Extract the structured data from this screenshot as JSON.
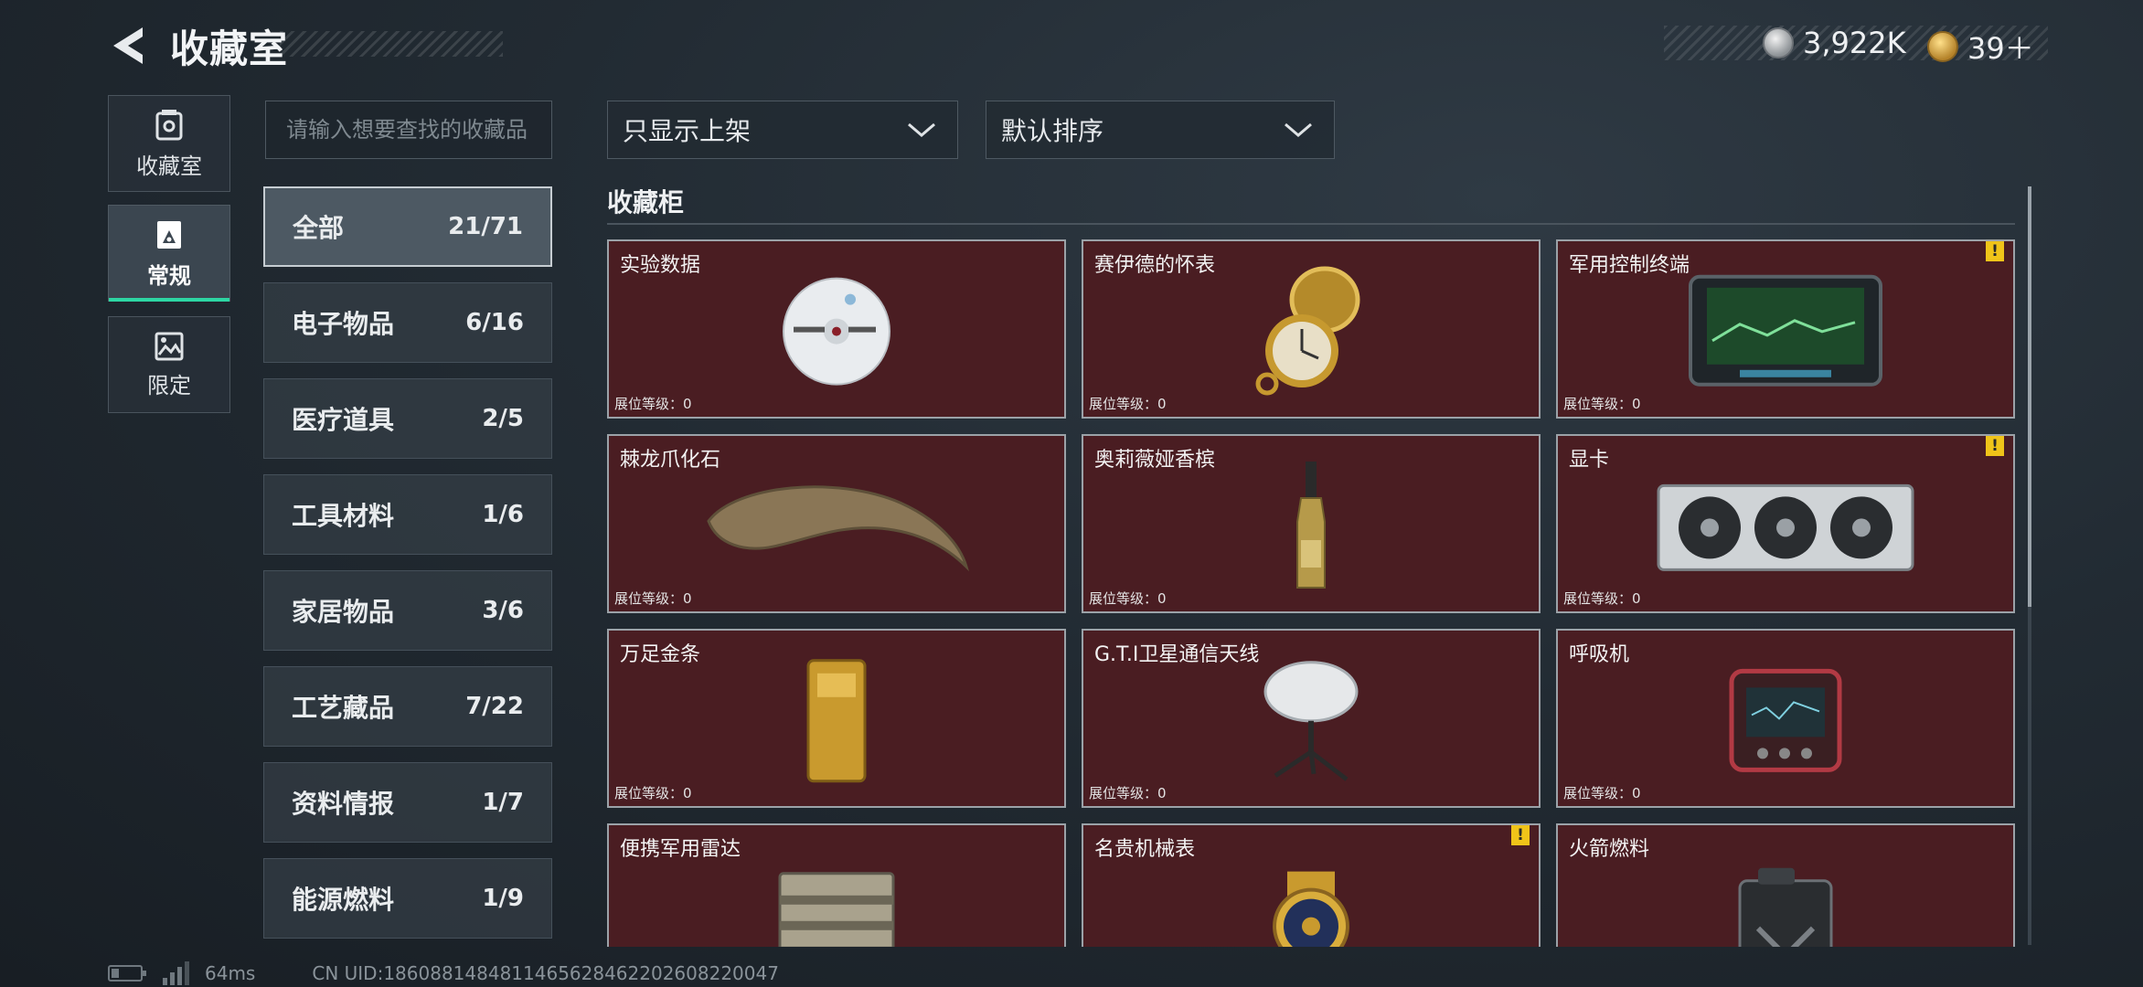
{
  "header": {
    "back_icon": "back-chevron-icon",
    "title": "收藏室",
    "currency": [
      {
        "icon": "silver-coin-icon",
        "value": "3,922K",
        "color": "#c9ccce"
      },
      {
        "icon": "gold-coin-icon",
        "value": "39＋",
        "color": "#d4a73d"
      }
    ]
  },
  "nav_tabs": [
    {
      "label": "收藏室",
      "icon": "vault-icon",
      "active": false
    },
    {
      "label": "常规",
      "icon": "regular-card-icon",
      "active": true
    },
    {
      "label": "限定",
      "icon": "limited-picture-icon",
      "active": false
    }
  ],
  "search": {
    "placeholder": "请输入想要查找的收藏品",
    "value": ""
  },
  "categories": [
    {
      "name": "全部",
      "count": "21/71",
      "active": true
    },
    {
      "name": "电子物品",
      "count": "6/16"
    },
    {
      "name": "医疗道具",
      "count": "2/5"
    },
    {
      "name": "工具材料",
      "count": "1/6"
    },
    {
      "name": "家居物品",
      "count": "3/6"
    },
    {
      "name": "工艺藏品",
      "count": "7/22"
    },
    {
      "name": "资料情报",
      "count": "1/7"
    },
    {
      "name": "能源燃料",
      "count": "1/9"
    }
  ],
  "filters": {
    "display_filter": {
      "value": "只显示上架",
      "icon": "chevron-down-icon"
    },
    "sort": {
      "value": "默认排序",
      "icon": "chevron-down-icon"
    }
  },
  "section_title": "收藏柜",
  "level_label": "展位等级：",
  "items": [
    {
      "name": "实验数据",
      "level": "0",
      "warn": false,
      "icon": "cd-disc-icon"
    },
    {
      "name": "赛伊德的怀表",
      "level": "0",
      "warn": false,
      "icon": "pocket-watch-icon"
    },
    {
      "name": "军用控制终端",
      "level": "0",
      "warn": true,
      "icon": "military-terminal-icon"
    },
    {
      "name": "棘龙爪化石",
      "level": "0",
      "warn": false,
      "icon": "claw-fossil-icon"
    },
    {
      "name": "奥莉薇娅香槟",
      "level": "0",
      "warn": false,
      "icon": "champagne-bottle-icon"
    },
    {
      "name": "显卡",
      "level": "0",
      "warn": true,
      "icon": "graphics-card-icon"
    },
    {
      "name": "万足金条",
      "level": "0",
      "warn": false,
      "icon": "gold-bar-icon"
    },
    {
      "name": "G.T.I卫星通信天线",
      "level": "0",
      "warn": false,
      "icon": "satellite-dish-icon"
    },
    {
      "name": "呼吸机",
      "level": "0",
      "warn": false,
      "icon": "ventilator-icon"
    },
    {
      "name": "便携军用雷达",
      "level": "",
      "warn": false,
      "icon": "portable-radar-icon"
    },
    {
      "name": "名贵机械表",
      "level": "",
      "warn": true,
      "icon": "luxury-watch-icon"
    },
    {
      "name": "火箭燃料",
      "level": "",
      "warn": false,
      "icon": "fuel-canister-icon"
    }
  ],
  "warn_symbol": "!",
  "footer": {
    "battery_icon": "battery-icon",
    "signal_icon": "signal-bars-icon",
    "ping": "64ms",
    "uid": "CN UID:1860881484811465628462202608220047"
  }
}
